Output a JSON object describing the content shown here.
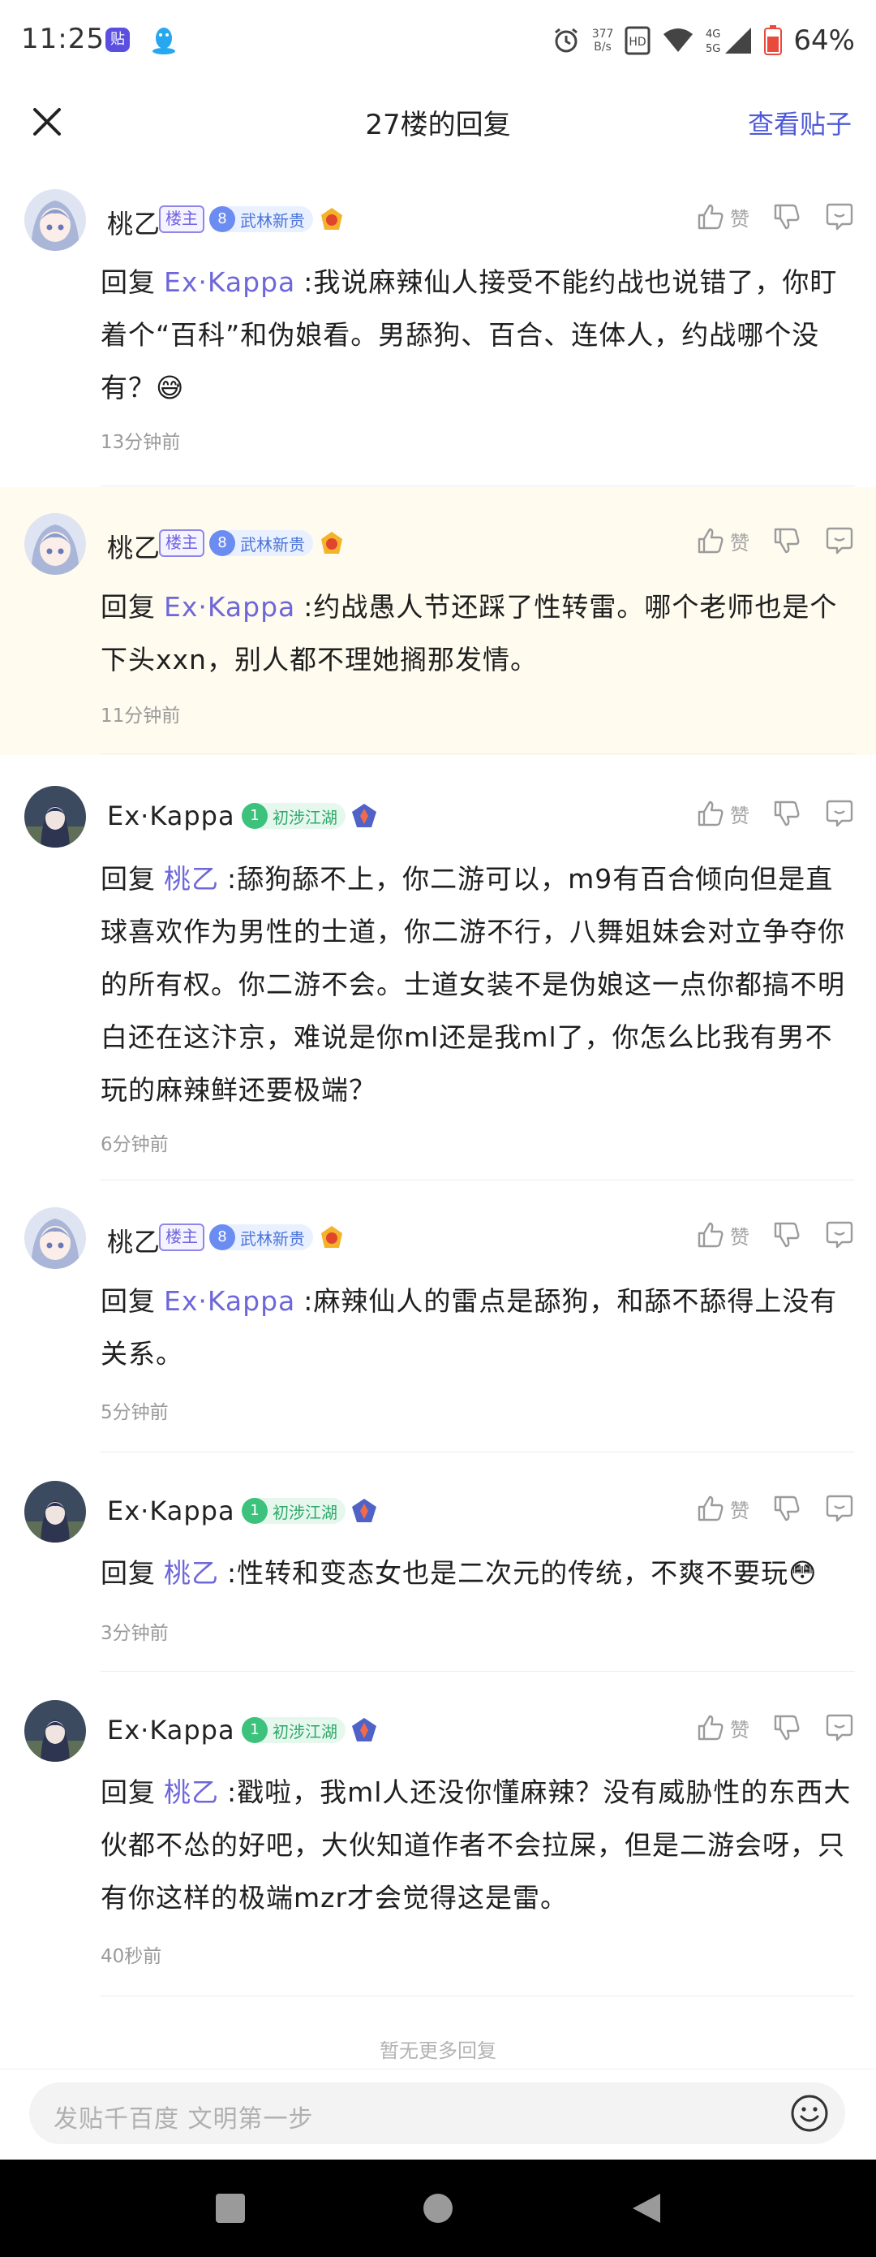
{
  "status_bar": {
    "time": "11:25",
    "app1_glyph": "贴",
    "net_speed_value": "377",
    "net_speed_unit": "B/s",
    "signal": "4G 5G",
    "battery": "64%"
  },
  "header": {
    "title": "27楼的回复",
    "view_post": "查看贴子"
  },
  "reply_label": "回复",
  "like_label": "赞",
  "badges": {
    "owner": "楼主",
    "level_8": "8",
    "level_8_title": "武林新贵",
    "level_1": "1",
    "level_1_title": "初涉江湖"
  },
  "replies": [
    {
      "user": "桃乙",
      "target": "Ex·Kappa",
      "text": ":我说麻辣仙人接受不能约战也说错了，你盯着个“百科”和伪娘看。男舔狗、百合、连体人，约战哪个没有？😅",
      "time": "13分钟前"
    },
    {
      "user": "桃乙",
      "target": "Ex·Kappa",
      "text": ":约战愚人节还踩了性转雷。哪个老师也是个下头xxn，别人都不理她搁那发情。",
      "time": "11分钟前"
    },
    {
      "user": "Ex·Kappa",
      "target": "桃乙",
      "text": ":舔狗舔不上，你二游可以，m9有百合倾向但是直球喜欢作为男性的士道，你二游不行，八舞姐妹会对立争夺你的所有权。你二游不会。士道女装不是伪娘这一点你都搞不明白还在这汴京，难说是你ml还是我ml了，你怎么比我有男不玩的麻辣鲜还要极端？",
      "time": "6分钟前"
    },
    {
      "user": "桃乙",
      "target": "Ex·Kappa",
      "text": ":麻辣仙人的雷点是舔狗，和舔不舔得上没有关系。",
      "time": "5分钟前"
    },
    {
      "user": "Ex·Kappa",
      "target": "桃乙",
      "text": ":性转和变态女也是二次元的传统，不爽不要玩😳",
      "time": "3分钟前"
    },
    {
      "user": "Ex·Kappa",
      "target": "桃乙",
      "text": ":戳啦，我ml人还没你懂麻辣？没有威胁性的东西大伙都不怂的好吧，大伙知道作者不会拉屎，但是二游会呀，只有你这样的极端mzr才会觉得这是雷。",
      "time": "40秒前"
    }
  ],
  "footer": {
    "no_more": "暂无更多回复",
    "input_placeholder": "发贴千百度 文明第一步"
  }
}
